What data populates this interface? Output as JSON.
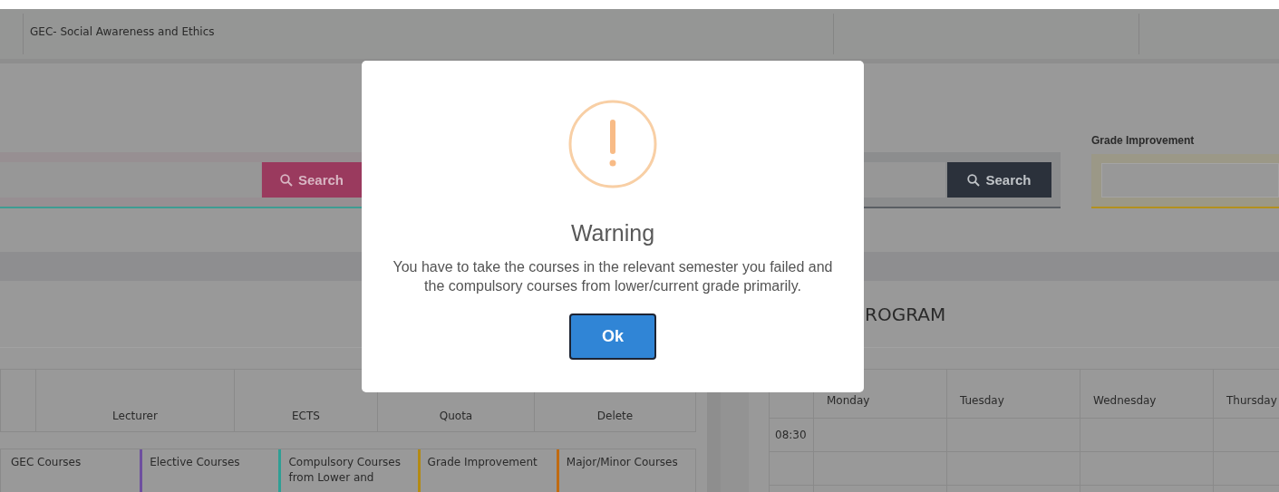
{
  "top_row": {
    "cells": [
      "GEC- Social Awareness and Ethics"
    ]
  },
  "search_left": {
    "button": "Search"
  },
  "search_right": {
    "button": "Search"
  },
  "grade_improvement": {
    "label": "Grade Improvement"
  },
  "course_table": {
    "columns": [
      "Lecturer",
      "ECTS",
      "Quota",
      "Delete"
    ]
  },
  "legend": [
    {
      "label": "GEC Courses"
    },
    {
      "label": "Elective Courses",
      "color": "#6e4fa0"
    },
    {
      "label": "Compulsory Courses from Lower and",
      "color": "#2f9f95"
    },
    {
      "label": "Grade Improvement",
      "color": "#b38a14"
    },
    {
      "label": "Major/Minor Courses",
      "color": "#c06a10"
    }
  ],
  "program": {
    "title": "ROGRAM",
    "days": [
      "Monday",
      "Tuesday",
      "Wednesday",
      "Thursday"
    ],
    "times": [
      "08:30"
    ]
  },
  "dialog": {
    "title": "Warning",
    "message": "You have to take the courses in the relevant semester you failed and the compulsory courses from lower/current grade primarily.",
    "button": "Ok"
  }
}
